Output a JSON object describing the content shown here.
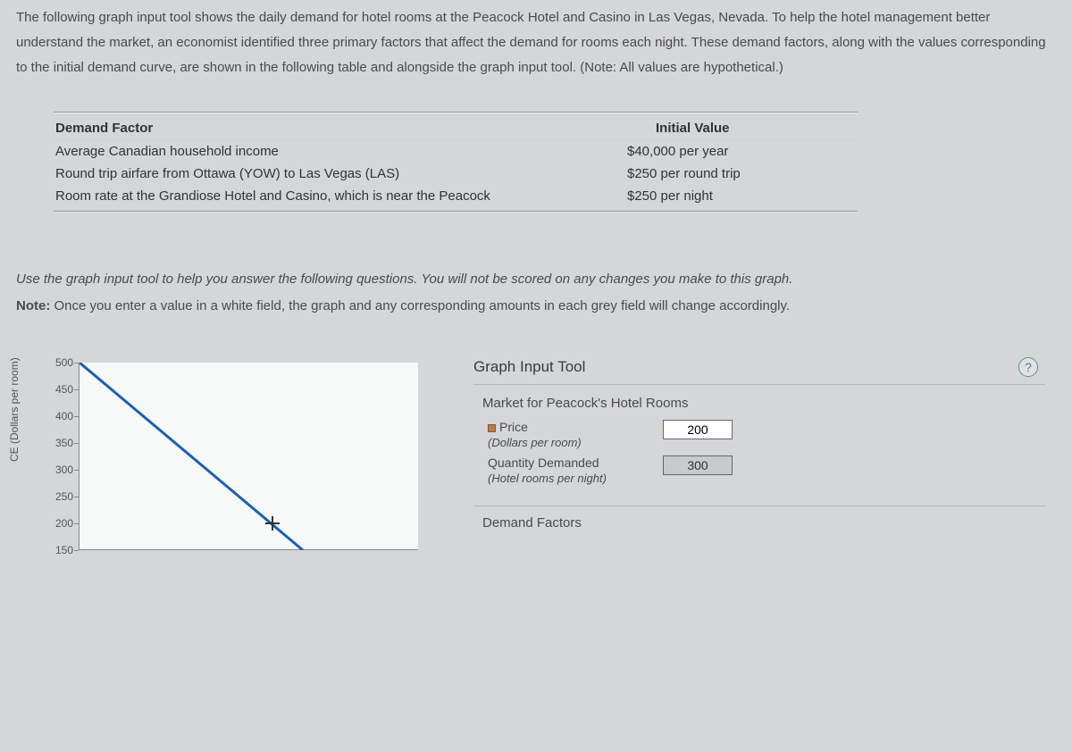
{
  "intro": "The following graph input tool shows the daily demand for hotel rooms at the Peacock Hotel and Casino in Las Vegas, Nevada. To help the hotel management better understand the market, an economist identified three primary factors that affect the demand for rooms each night. These demand factors, along with the values corresponding to the initial demand curve, are shown in the following table and alongside the graph input tool. (Note: All values are hypothetical.)",
  "table": {
    "header": {
      "col1": "Demand Factor",
      "col2": "Initial Value"
    },
    "rows": [
      {
        "factor": "Average Canadian household income",
        "value": "$40,000 per year"
      },
      {
        "factor": "Round trip airfare from Ottawa (YOW) to Las Vegas (LAS)",
        "value": "$250 per round trip"
      },
      {
        "factor": "Room rate at the Grandiose Hotel and Casino, which is near the Peacock",
        "value": "$250 per night"
      }
    ]
  },
  "instruction_italic": "Use the graph input tool to help you answer the following questions. You will not be scored on any changes you make to this graph.",
  "note_label": "Note: ",
  "note_text": "Once you enter a value in a white field, the graph and any corresponding amounts in each grey field will change accordingly.",
  "panel": {
    "title": "Graph Input Tool",
    "subtitle": "Market for Peacock's Hotel Rooms",
    "help": "?",
    "fields": {
      "price": {
        "label": "Price",
        "sub": "(Dollars per room)",
        "value": "200"
      },
      "qty": {
        "label": "Quantity Demanded",
        "sub": "(Hotel rooms per night)",
        "value": "300"
      }
    },
    "section2": "Demand Factors"
  },
  "chart_data": {
    "type": "line",
    "title": "",
    "ylabel": "CE (Dollars per room)",
    "xlabel": "",
    "ylim": [
      150,
      500
    ],
    "y_ticks": [
      500,
      450,
      400,
      350,
      300,
      250,
      200,
      150
    ],
    "series": [
      {
        "name": "Demand",
        "points": [
          [
            0,
            500
          ],
          [
            300,
            200
          ]
        ]
      }
    ],
    "marker": {
      "x": 300,
      "y": 200
    }
  }
}
